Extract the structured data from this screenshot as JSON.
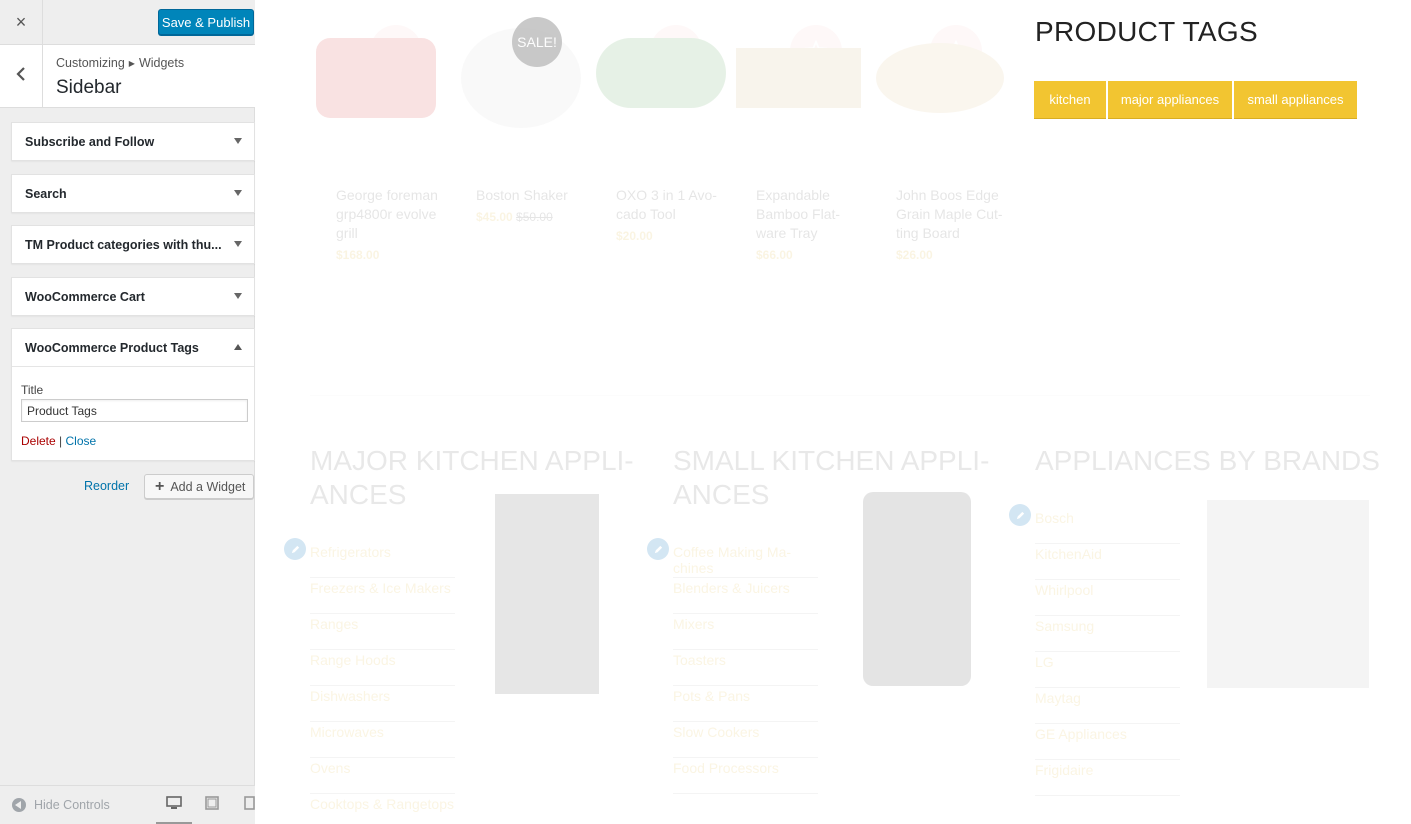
{
  "topbar": {
    "close_icon": "×",
    "save_label": "Save & Publish"
  },
  "section": {
    "crumb_root": "Customizing",
    "crumb_child": "Widgets",
    "title": "Sidebar"
  },
  "widgets": [
    {
      "label": "Subscribe and Follow"
    },
    {
      "label": "Search"
    },
    {
      "label": "TM Product categories with thu..."
    },
    {
      "label": "WooCommerce Cart"
    },
    {
      "label": "WooCommerce Product Tags"
    }
  ],
  "tags_widget": {
    "title_label": "Title",
    "title_value": "Product Tags",
    "delete_label": "Delete",
    "separator": "|",
    "close_label": "Close"
  },
  "actions": {
    "reorder_label": "Reorder",
    "add_widget_label": "Add a Widget"
  },
  "footer": {
    "hide_controls_label": "Hide Controls"
  },
  "preview": {
    "products": [
      {
        "name": "George foreman grp4800r evolve grill",
        "price": "$168.00",
        "old_price": ""
      },
      {
        "name": "Boston Shaker",
        "price": "$45.00",
        "old_price": "$50.00"
      },
      {
        "name": "OXO 3 in 1 Avo-cado Tool",
        "price": "$20.00",
        "old_price": ""
      },
      {
        "name": "Expandable Bamboo Flat-ware Tray",
        "price": "$66.00",
        "old_price": ""
      },
      {
        "name": "John Boos Edge Grain Maple Cut-ting Board",
        "price": "$26.00",
        "old_price": ""
      }
    ],
    "sale_badge": "SALE!",
    "tags_title": "PRODUCT TAGS",
    "tags": [
      "kitchen",
      "major appliances",
      "small appliances"
    ],
    "major": {
      "title_line1": "MAJOR KITCHEN APPLI-",
      "title_line2": "ANCES",
      "items": [
        "Refrigerators",
        "Freezers & Ice Makers",
        "Ranges",
        "Range Hoods",
        "Dishwashers",
        "Microwaves",
        "Ovens",
        "Cooktops & Rangetops"
      ]
    },
    "small": {
      "title_line1": "SMALL KITCHEN APPLI-",
      "title_line2": "ANCES",
      "items": [
        "Coffee Making Ma-chines",
        "Blenders & Juicers",
        "Mixers",
        "Toasters",
        "Pots & Pans",
        "Slow Cookers",
        "Food Processors"
      ]
    },
    "brands": {
      "title": "APPLIANCES BY BRANDS",
      "items": [
        "Bosch",
        "KitchenAid",
        "Whirlpool",
        "Samsung",
        "LG",
        "Maytag",
        "GE Appliances",
        "Frigidaire"
      ]
    }
  },
  "colors": {
    "primary": "#0085ba",
    "tag": "#f2c531",
    "badge": "#f9c4c8",
    "link": "#0073aa",
    "delete": "#a00"
  }
}
